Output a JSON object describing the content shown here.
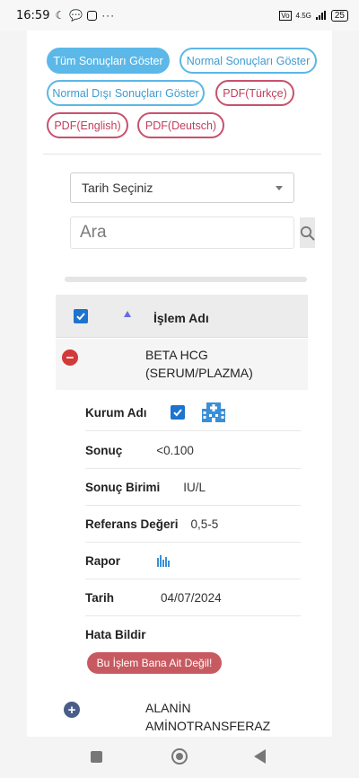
{
  "status_bar": {
    "time": "16:59",
    "net_label": "4.5G",
    "battery": "25"
  },
  "filters": {
    "all_results": "Tüm Sonuçları Göster",
    "normal_results": "Normal Sonuçları Göster",
    "abnormal_results": "Normal Dışı Sonuçları Göster",
    "pdf_tr": "PDF(Türkçe)",
    "pdf_en": "PDF(English)",
    "pdf_de": "PDF(Deutsch)"
  },
  "date_select": {
    "value": "Tarih Seçiniz"
  },
  "search": {
    "placeholder": "Ara"
  },
  "table": {
    "header_label": "İşlem Adı",
    "rows": [
      {
        "name_line1": "BETA HCG",
        "name_line2": "(SERUM/PLAZMA)"
      },
      {
        "name_line1": "ALANİN",
        "name_line2": "AMİNOTRANSFERAZ"
      }
    ]
  },
  "detail": {
    "institution_label": "Kurum Adı",
    "result_label": "Sonuç",
    "result_value": "<0.100",
    "unit_label": "Sonuç Birimi",
    "unit_value": "IU/L",
    "reference_label": "Referans Değeri",
    "reference_value": "0,5-5",
    "report_label": "Rapor",
    "date_label": "Tarih",
    "date_value": "04/07/2024",
    "error_label": "Hata Bildir",
    "error_button": "Bu İşlem Bana Ait Değil!"
  },
  "colors": {
    "blue": "#5cb8e8",
    "red": "#c9516d",
    "error_button": "#c75a60",
    "checkbox": "#1d73d0",
    "icon_blue": "#3a8fd6"
  }
}
